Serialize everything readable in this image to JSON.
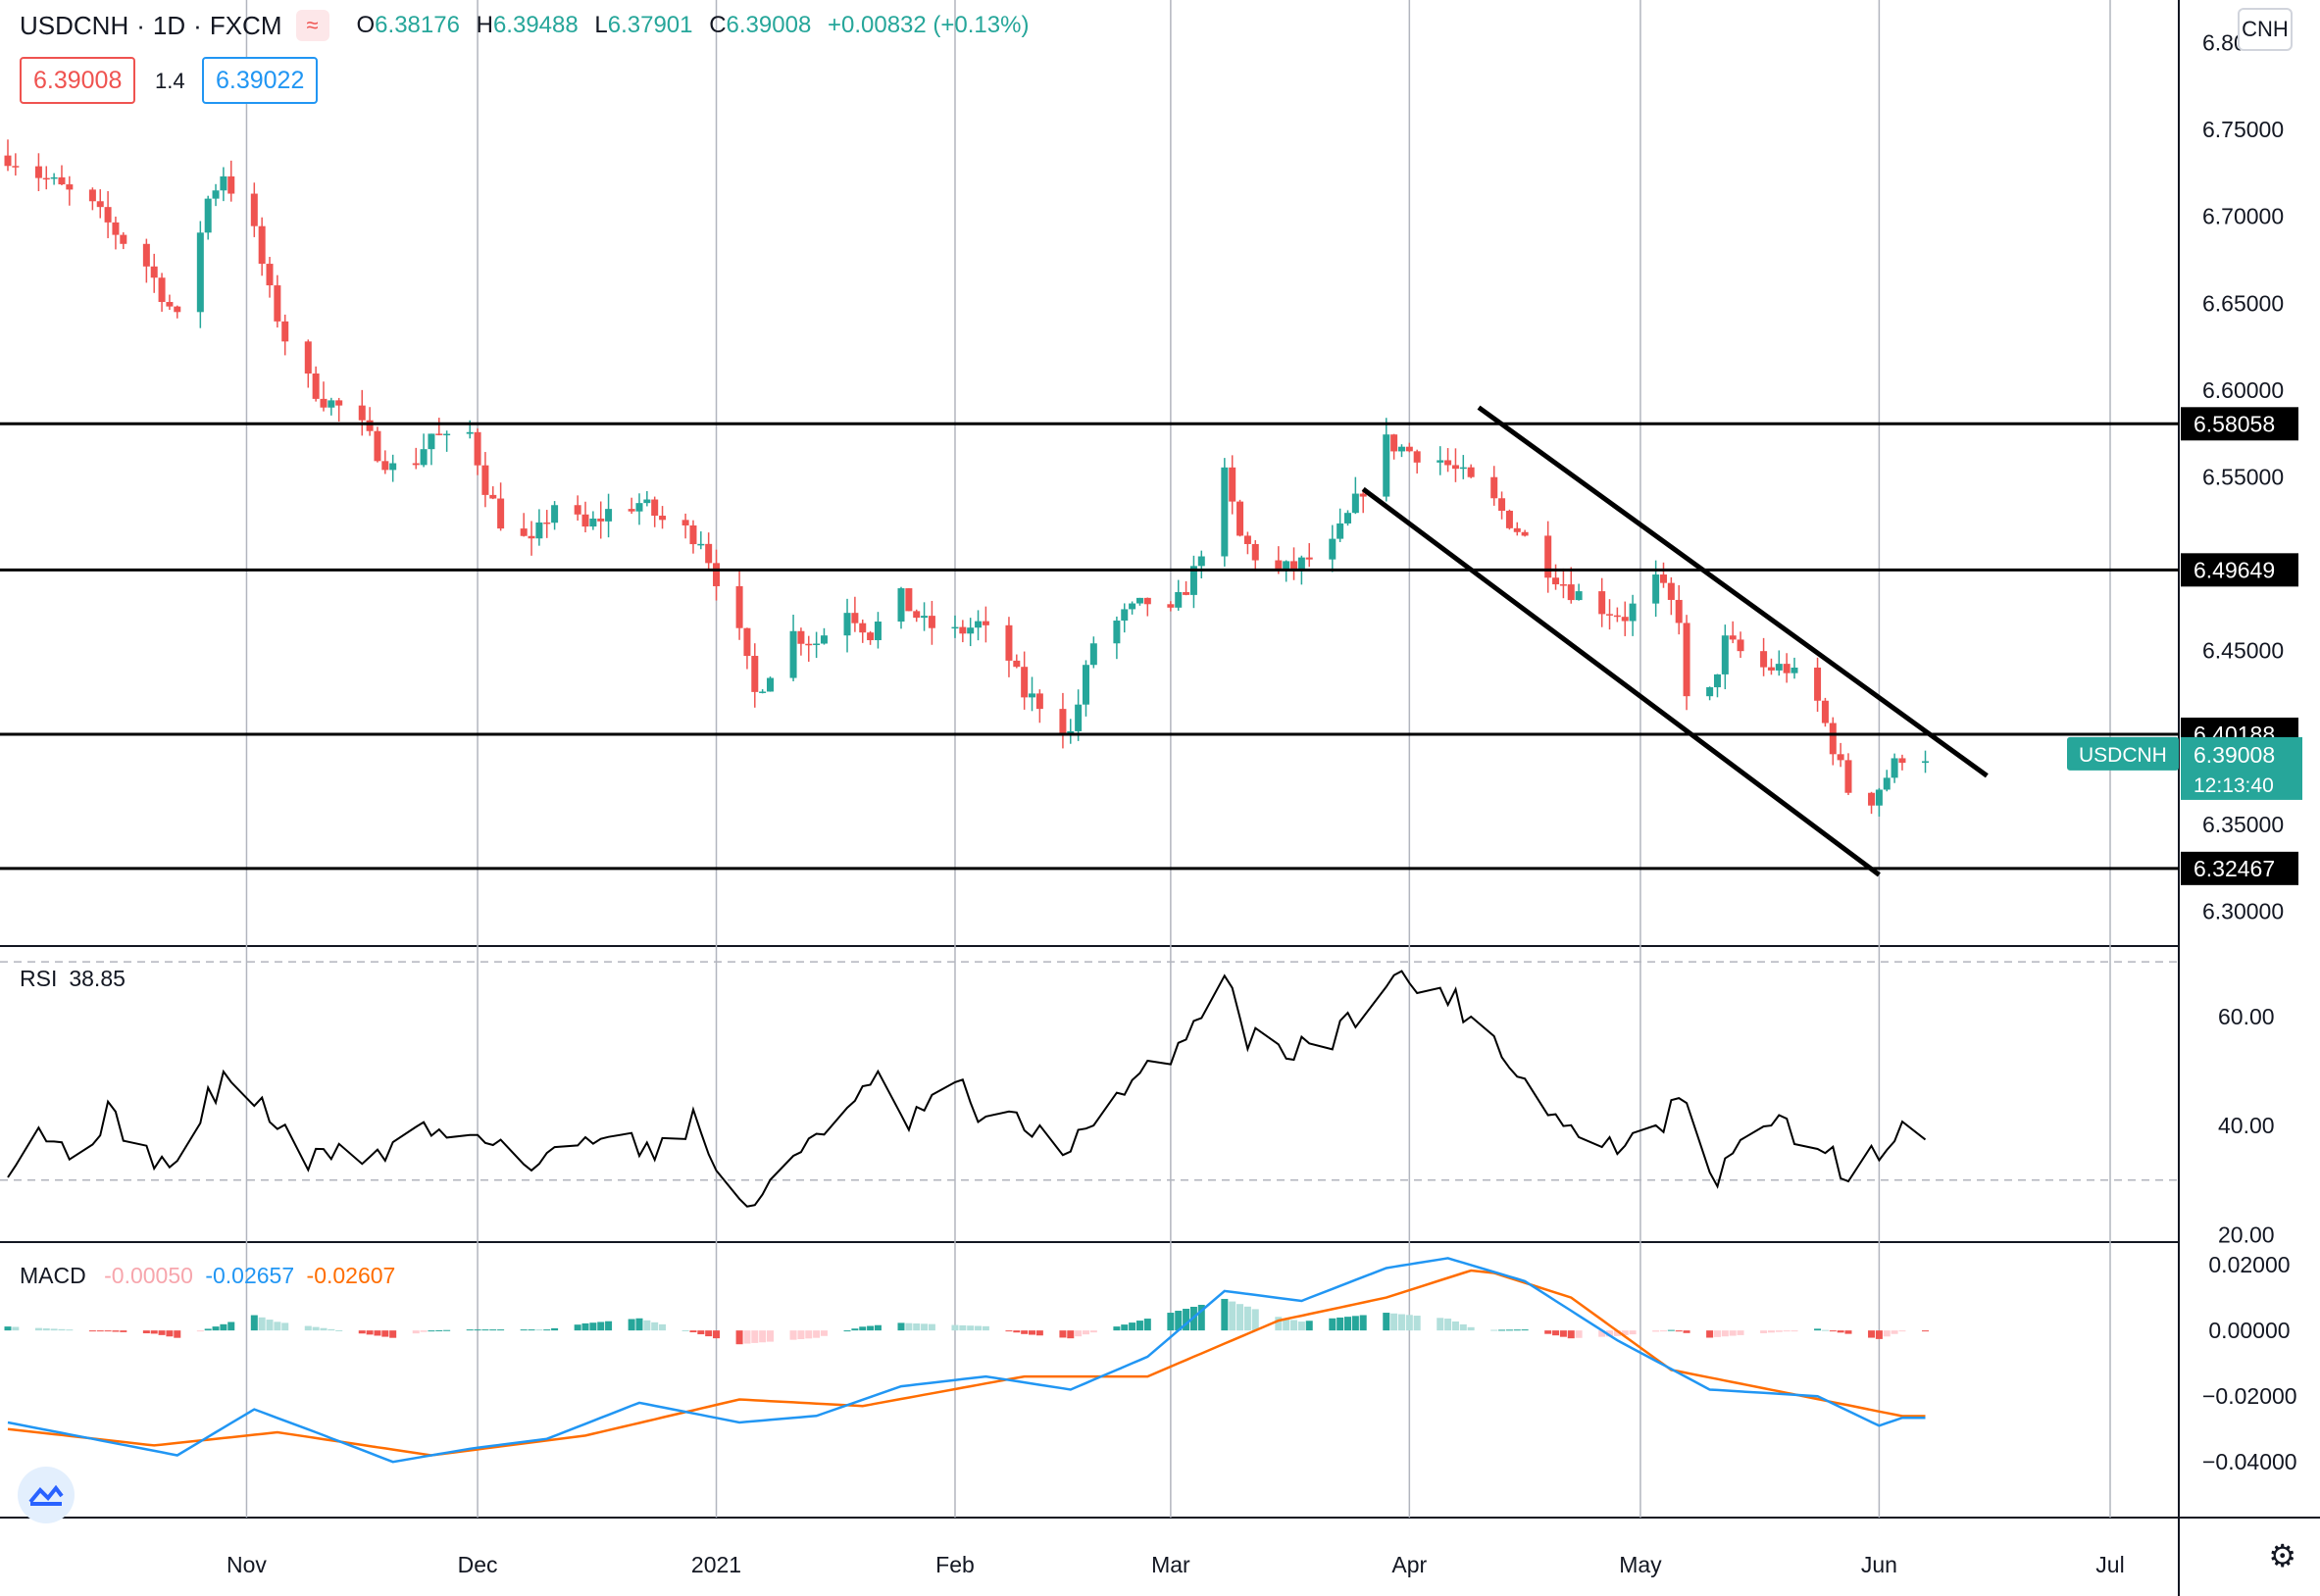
{
  "header": {
    "symbol": "USDCNH",
    "interval": "1D",
    "exchange": "FXCM",
    "open_label": "O",
    "open": "6.38176",
    "high_label": "H",
    "high": "6.39488",
    "low_label": "L",
    "low": "6.37901",
    "close_label": "C",
    "close": "6.39008",
    "change": "+0.00832 (+0.13%)",
    "bid": "6.39008",
    "spread": "1.4",
    "ask": "6.39022",
    "currency_button": "CNH",
    "wave_icon": "wave-icon"
  },
  "colors": {
    "up": "#26a69a",
    "down": "#ef5350",
    "line": "#000000",
    "macd": "#2196f3",
    "signal": "#ff6d00",
    "hist_up_strong": "#26a69a",
    "hist_up_weak": "#b2dfdb",
    "hist_down_strong": "#ef5350",
    "hist_down_weak": "#ffcdd2"
  },
  "rsi": {
    "label": "RSI",
    "value": "38.85"
  },
  "macd": {
    "label": "MACD",
    "hist": "-0.00050",
    "macd": "-0.02657",
    "signal": "-0.02607"
  },
  "price_tag": {
    "symbol": "USDCNH",
    "price": "6.39008",
    "countdown": "12:13:40"
  },
  "chart_data": [
    {
      "type": "candlestick",
      "title": "USDCNH · 1D · FXCM",
      "ylim": [
        6.28,
        6.82
      ],
      "x_ticks": [
        "Nov",
        "Dec",
        "2021",
        "Feb",
        "Mar",
        "Apr",
        "May",
        "Jun",
        "Jul"
      ],
      "y_ticks": [
        6.3,
        6.35,
        6.45,
        6.55,
        6.6,
        6.65,
        6.7,
        6.75,
        6.8
      ],
      "start_date": "2020-10-01",
      "end_date": "2021-06-07",
      "horizontal_levels": [
        {
          "value": 6.58058,
          "label": "6.58058"
        },
        {
          "value": 6.49649,
          "label": "6.49649"
        },
        {
          "value": 6.40188,
          "label": "6.40188"
        },
        {
          "value": 6.32467,
          "label": "6.32467"
        }
      ],
      "channel_lines": [
        {
          "from": [
            "2021-04-10",
            6.59
          ],
          "to": [
            "2021-06-15",
            6.378
          ]
        },
        {
          "from": [
            "2021-03-26",
            6.543
          ],
          "to": [
            "2021-06-01",
            6.321
          ]
        }
      ],
      "close_anchors": [
        [
          "2020-10-01",
          6.735
        ],
        [
          "2020-10-12",
          6.705
        ],
        [
          "2020-10-19",
          6.672
        ],
        [
          "2020-10-23",
          6.64
        ],
        [
          "2020-10-27",
          6.71
        ],
        [
          "2020-10-29",
          6.725
        ],
        [
          "2020-11-02",
          6.69
        ],
        [
          "2020-11-04",
          6.655
        ],
        [
          "2020-11-06",
          6.63
        ],
        [
          "2020-11-09",
          6.605
        ],
        [
          "2020-11-11",
          6.595
        ],
        [
          "2020-11-13",
          6.59
        ],
        [
          "2020-11-16",
          6.578
        ],
        [
          "2020-11-18",
          6.565
        ],
        [
          "2020-11-20",
          6.555
        ],
        [
          "2020-11-23",
          6.56
        ],
        [
          "2020-11-25",
          6.575
        ],
        [
          "2020-11-27",
          6.57
        ],
        [
          "2020-11-30",
          6.575
        ],
        [
          "2020-12-02",
          6.545
        ],
        [
          "2020-12-04",
          6.525
        ],
        [
          "2020-12-08",
          6.51
        ],
        [
          "2020-12-11",
          6.535
        ],
        [
          "2020-12-15",
          6.52
        ],
        [
          "2020-12-18",
          6.53
        ],
        [
          "2020-12-22",
          6.535
        ],
        [
          "2020-12-25",
          6.525
        ],
        [
          "2020-12-30",
          6.515
        ],
        [
          "2021-01-04",
          6.458
        ],
        [
          "2021-01-06",
          6.425
        ],
        [
          "2021-01-11",
          6.46
        ],
        [
          "2021-01-14",
          6.455
        ],
        [
          "2021-01-18",
          6.475
        ],
        [
          "2021-01-21",
          6.46
        ],
        [
          "2021-01-25",
          6.48
        ],
        [
          "2021-01-28",
          6.465
        ],
        [
          "2021-02-01",
          6.46
        ],
        [
          "2021-02-04",
          6.465
        ],
        [
          "2021-02-08",
          6.445
        ],
        [
          "2021-02-10",
          6.425
        ],
        [
          "2021-02-12",
          6.42
        ],
        [
          "2021-02-16",
          6.402
        ],
        [
          "2021-02-19",
          6.455
        ],
        [
          "2021-02-23",
          6.47
        ],
        [
          "2021-02-26",
          6.478
        ],
        [
          "2021-03-01",
          6.47
        ],
        [
          "2021-03-04",
          6.495
        ],
        [
          "2021-03-08",
          6.55
        ],
        [
          "2021-03-10",
          6.515
        ],
        [
          "2021-03-12",
          6.505
        ],
        [
          "2021-03-15",
          6.495
        ],
        [
          "2021-03-18",
          6.5
        ],
        [
          "2021-03-22",
          6.51
        ],
        [
          "2021-03-25",
          6.535
        ],
        [
          "2021-03-29",
          6.57
        ],
        [
          "2021-04-01",
          6.565
        ],
        [
          "2021-04-05",
          6.56
        ],
        [
          "2021-04-08",
          6.55
        ],
        [
          "2021-04-12",
          6.535
        ],
        [
          "2021-04-15",
          6.52
        ],
        [
          "2021-04-19",
          6.498
        ],
        [
          "2021-04-22",
          6.485
        ],
        [
          "2021-04-26",
          6.475
        ],
        [
          "2021-04-29",
          6.47
        ],
        [
          "2021-05-03",
          6.49
        ],
        [
          "2021-05-06",
          6.47
        ],
        [
          "2021-05-07",
          6.42
        ],
        [
          "2021-05-10",
          6.425
        ],
        [
          "2021-05-12",
          6.455
        ],
        [
          "2021-05-17",
          6.44
        ],
        [
          "2021-05-20",
          6.44
        ],
        [
          "2021-05-24",
          6.42
        ],
        [
          "2021-05-26",
          6.395
        ],
        [
          "2021-05-28",
          6.37
        ],
        [
          "2021-05-31",
          6.365
        ],
        [
          "2021-06-02",
          6.378
        ],
        [
          "2021-06-04",
          6.39
        ]
      ]
    },
    {
      "type": "line",
      "title": "RSI",
      "ylim": [
        19,
        72
      ],
      "y_ticks": [
        20.0,
        40.0,
        60.0
      ],
      "bands": [
        30,
        70
      ],
      "series": [
        {
          "name": "RSI",
          "values_anchor": [
            [
              "2020-10-01",
              33
            ],
            [
              "2020-10-05",
              40
            ],
            [
              "2020-10-09",
              34
            ],
            [
              "2020-10-14",
              42
            ],
            [
              "2020-10-19",
              35
            ],
            [
              "2020-10-23",
              32
            ],
            [
              "2020-10-27",
              45
            ],
            [
              "2020-10-30",
              49
            ],
            [
              "2020-11-04",
              42
            ],
            [
              "2020-11-09",
              33
            ],
            [
              "2020-11-13",
              36
            ],
            [
              "2020-11-18",
              34
            ],
            [
              "2020-11-23",
              40
            ],
            [
              "2020-11-27",
              38
            ],
            [
              "2020-12-01",
              39
            ],
            [
              "2020-12-04",
              37
            ],
            [
              "2020-12-08",
              32
            ],
            [
              "2020-12-14",
              37
            ],
            [
              "2020-12-18",
              40
            ],
            [
              "2020-12-23",
              35
            ],
            [
              "2020-12-29",
              41
            ],
            [
              "2021-01-04",
              25
            ],
            [
              "2021-01-08",
              28
            ],
            [
              "2021-01-13",
              38
            ],
            [
              "2021-01-19",
              44
            ],
            [
              "2021-01-22",
              48
            ],
            [
              "2021-01-26",
              40
            ],
            [
              "2021-02-01",
              48
            ],
            [
              "2021-02-04",
              42
            ],
            [
              "2021-02-10",
              40
            ],
            [
              "2021-02-16",
              36
            ],
            [
              "2021-02-22",
              44
            ],
            [
              "2021-02-26",
              50
            ],
            [
              "2021-03-03",
              56
            ],
            [
              "2021-03-08",
              69
            ],
            [
              "2021-03-11",
              56
            ],
            [
              "2021-03-16",
              54
            ],
            [
              "2021-03-22",
              56
            ],
            [
              "2021-03-26",
              62
            ],
            [
              "2021-03-30",
              67
            ],
            [
              "2021-04-06",
              64
            ],
            [
              "2021-04-12",
              56
            ],
            [
              "2021-04-16",
              48
            ],
            [
              "2021-04-21",
              40
            ],
            [
              "2021-04-26",
              36
            ],
            [
              "2021-05-03",
              38
            ],
            [
              "2021-05-06",
              45
            ],
            [
              "2021-05-11",
              30
            ],
            [
              "2021-05-17",
              42
            ],
            [
              "2021-05-21",
              38
            ],
            [
              "2021-05-26",
              35
            ],
            [
              "2021-05-28",
              30
            ],
            [
              "2021-06-01",
              36
            ],
            [
              "2021-06-04",
              39
            ]
          ]
        }
      ]
    },
    {
      "type": "line",
      "title": "MACD",
      "ylim": [
        -0.048,
        0.026
      ],
      "y_ticks": [
        0.02,
        0.0,
        -0.02,
        -0.04
      ],
      "series": [
        {
          "name": "MACD",
          "values_anchor": [
            [
              "2020-10-01",
              -0.028
            ],
            [
              "2020-10-12",
              -0.033
            ],
            [
              "2020-10-23",
              -0.038
            ],
            [
              "2020-11-02",
              -0.024
            ],
            [
              "2020-11-10",
              -0.031
            ],
            [
              "2020-11-20",
              -0.04
            ],
            [
              "2020-11-30",
              -0.036
            ],
            [
              "2020-12-10",
              -0.033
            ],
            [
              "2020-12-22",
              -0.022
            ],
            [
              "2021-01-04",
              -0.028
            ],
            [
              "2021-01-14",
              -0.026
            ],
            [
              "2021-01-25",
              -0.017
            ],
            [
              "2021-02-05",
              -0.014
            ],
            [
              "2021-02-16",
              -0.018
            ],
            [
              "2021-02-26",
              -0.008
            ],
            [
              "2021-03-08",
              0.012
            ],
            [
              "2021-03-18",
              0.009
            ],
            [
              "2021-03-29",
              0.019
            ],
            [
              "2021-04-06",
              0.022
            ],
            [
              "2021-04-16",
              0.015
            ],
            [
              "2021-04-28",
              -0.003
            ],
            [
              "2021-05-10",
              -0.018
            ],
            [
              "2021-05-24",
              -0.02
            ],
            [
              "2021-06-01",
              -0.029
            ],
            [
              "2021-06-04",
              -0.02657
            ]
          ]
        },
        {
          "name": "Signal",
          "values_anchor": [
            [
              "2020-10-01",
              -0.03
            ],
            [
              "2020-10-20",
              -0.035
            ],
            [
              "2020-11-05",
              -0.031
            ],
            [
              "2020-11-25",
              -0.038
            ],
            [
              "2020-12-15",
              -0.032
            ],
            [
              "2021-01-04",
              -0.021
            ],
            [
              "2021-01-20",
              -0.023
            ],
            [
              "2021-02-10",
              -0.014
            ],
            [
              "2021-02-26",
              -0.014
            ],
            [
              "2021-03-15",
              0.003
            ],
            [
              "2021-03-29",
              0.01
            ],
            [
              "2021-04-10",
              0.019
            ],
            [
              "2021-04-22",
              0.01
            ],
            [
              "2021-05-05",
              -0.012
            ],
            [
              "2021-05-20",
              -0.019
            ],
            [
              "2021-06-04",
              -0.02607
            ]
          ]
        }
      ]
    }
  ]
}
